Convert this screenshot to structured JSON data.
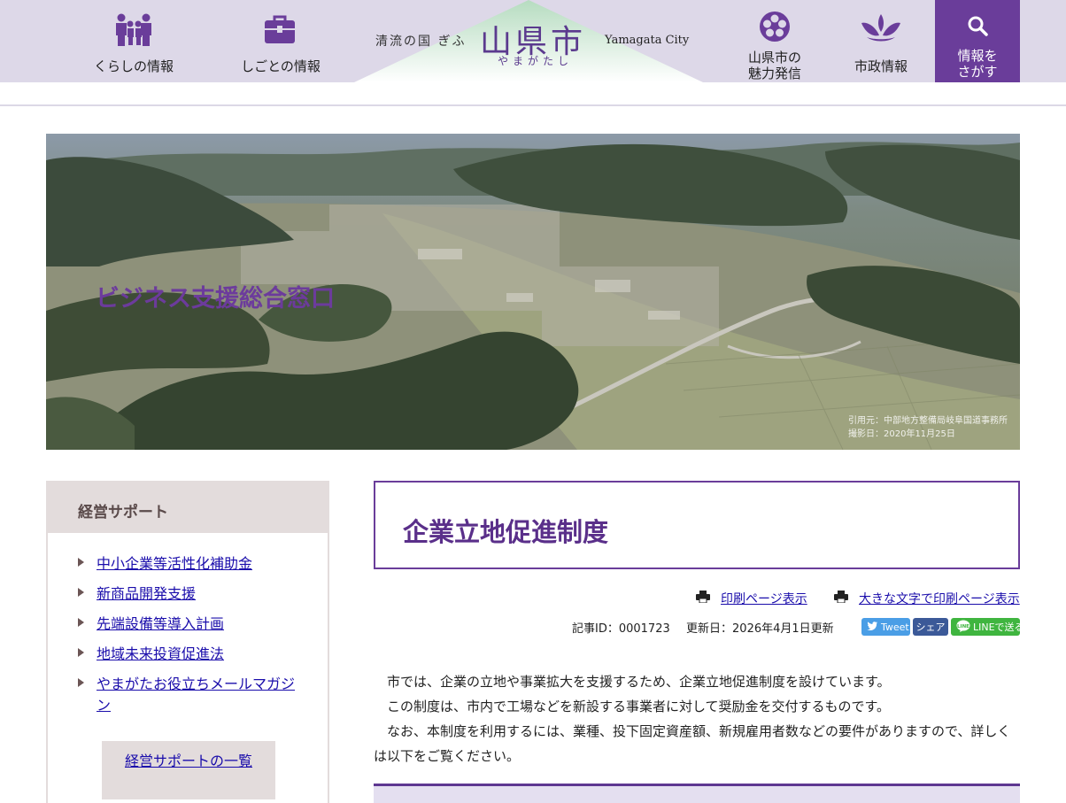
{
  "header": {
    "nav": {
      "life": "くらしの情報",
      "work": "しごとの情報",
      "charm_line1": "山県市の",
      "charm_line2": "魅力発信",
      "city": "市政情報",
      "search_line1": "情報を",
      "search_line2": "さがす"
    },
    "logo": {
      "tagline": "清流の国 ぎふ",
      "name": "山県市",
      "kana": "やまがたし",
      "english": "Yamagata City"
    },
    "icons": [
      "family-icon",
      "briefcase-icon",
      "flower-emblem-icon",
      "city-emblem-icon",
      "search-icon"
    ],
    "colors": {
      "header_bg": "#ddd8e8",
      "accent": "#6a3d9a"
    }
  },
  "hero": {
    "title": "ビジネス支援総合窓口",
    "credit_line1": "引用元：中部地方整備局岐阜国道事務所",
    "credit_line2": "撮影日：2020年11月25日"
  },
  "sidebar": {
    "heading": "経営サポート",
    "items": [
      "中小企業等活性化補助金",
      "新商品開発支援",
      "先端設備等導入計画",
      "地域未来投資促進法",
      "やまがたお役立ちメールマガジン"
    ],
    "list_button": "経営サポートの一覧"
  },
  "main": {
    "title": "企業立地促進制度",
    "print": "印刷ページ表示",
    "print_large": "大きな文字で印刷ページ表示",
    "article_id": "記事ID：0001723",
    "updated": "更新日：2026年4月1日更新",
    "share": {
      "tweet": "Tweet",
      "facebook": "シェア",
      "line": "LINEで送る"
    },
    "paragraphs": [
      "市では、企業の立地や事業拡大を支援するため、企業立地促進制度を設けています。",
      "この制度は、市内で工場などを新設する事業者に対して奨励金を交付するものです。",
      "なお、本制度を利用するには、業種、投下固定資産額、新規雇用者数などの要件がありますので、詳しくは以下をご覧ください。"
    ]
  }
}
